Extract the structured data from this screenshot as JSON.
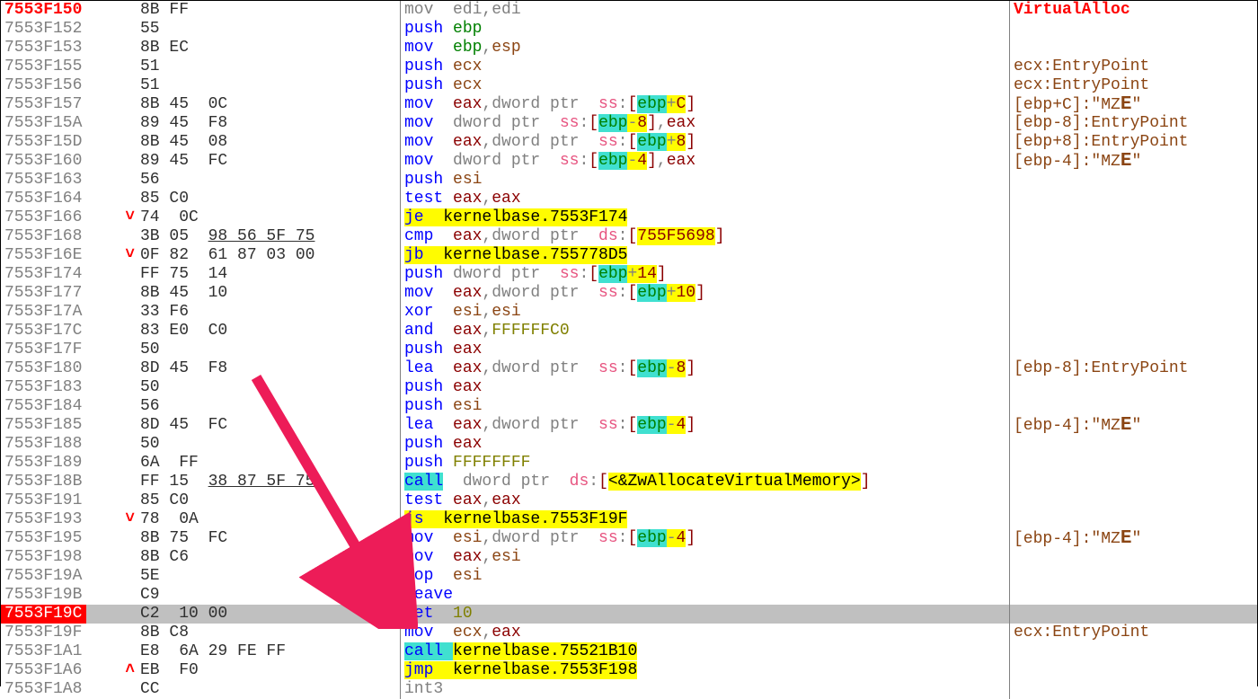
{
  "selected_index": 33,
  "rows": [
    {
      "addr": "7553F150",
      "addr_style": "entry",
      "jump": "",
      "bytes": "8B FF",
      "disasm": [
        [
          "c-gray",
          "mov  edi,edi"
        ]
      ],
      "comment": [
        [
          "c-red",
          "VirtualAlloc"
        ]
      ]
    },
    {
      "addr": "7553F152",
      "jump": "",
      "bytes": "55",
      "disasm": [
        [
          "c-blue",
          "push "
        ],
        [
          "c-green",
          "ebp"
        ]
      ],
      "comment": []
    },
    {
      "addr": "7553F153",
      "jump": "",
      "bytes": "8B EC",
      "disasm": [
        [
          "c-blue",
          "mov  "
        ],
        [
          "c-green",
          "ebp"
        ],
        [
          "c-gray",
          ","
        ],
        [
          "c-brown",
          "esp"
        ]
      ],
      "comment": []
    },
    {
      "addr": "7553F155",
      "jump": "",
      "bytes": "51",
      "disasm": [
        [
          "c-blue",
          "push "
        ],
        [
          "c-brown",
          "ecx"
        ]
      ],
      "comment": [
        [
          "c-brown",
          "ecx:EntryPoint"
        ]
      ]
    },
    {
      "addr": "7553F156",
      "jump": "",
      "bytes": "51",
      "disasm": [
        [
          "c-blue",
          "push "
        ],
        [
          "c-brown",
          "ecx"
        ]
      ],
      "comment": [
        [
          "c-brown",
          "ecx:EntryPoint"
        ]
      ]
    },
    {
      "addr": "7553F157",
      "jump": "",
      "bytes": "8B 45  0C",
      "disasm": [
        [
          "c-blue",
          "mov  "
        ],
        [
          "c-darkred",
          "eax"
        ],
        [
          "c-gray",
          ",dword ptr  "
        ],
        [
          "c-pink",
          "ss"
        ],
        [
          "c-gray",
          ":"
        ],
        [
          "c-darkred",
          "["
        ],
        [
          "c-green bg-cyan",
          "ebp"
        ],
        [
          "c-gray bg-yellow",
          "+"
        ],
        [
          "c-darkred bg-yellow",
          "C"
        ],
        [
          "c-darkred",
          "]"
        ]
      ],
      "comment": [
        [
          "c-brown",
          "[ebp+C]:\"MZ"
        ],
        [
          "c-brown big",
          "E"
        ],
        [
          "c-brown",
          "\""
        ]
      ]
    },
    {
      "addr": "7553F15A",
      "jump": "",
      "bytes": "89 45  F8",
      "disasm": [
        [
          "c-blue",
          "mov  "
        ],
        [
          "c-gray",
          "dword ptr  "
        ],
        [
          "c-pink",
          "ss"
        ],
        [
          "c-gray",
          ":"
        ],
        [
          "c-darkred",
          "["
        ],
        [
          "c-green bg-cyan",
          "ebp"
        ],
        [
          "c-gray bg-yellow",
          "-"
        ],
        [
          "c-darkred bg-yellow",
          "8"
        ],
        [
          "c-darkred",
          "]"
        ],
        [
          "c-gray",
          ","
        ],
        [
          "c-darkred",
          "eax"
        ]
      ],
      "comment": [
        [
          "c-brown",
          "[ebp-8]:EntryPoint"
        ]
      ]
    },
    {
      "addr": "7553F15D",
      "jump": "",
      "bytes": "8B 45  08",
      "disasm": [
        [
          "c-blue",
          "mov  "
        ],
        [
          "c-darkred",
          "eax"
        ],
        [
          "c-gray",
          ",dword ptr  "
        ],
        [
          "c-pink",
          "ss"
        ],
        [
          "c-gray",
          ":"
        ],
        [
          "c-darkred",
          "["
        ],
        [
          "c-green bg-cyan",
          "ebp"
        ],
        [
          "c-gray bg-yellow",
          "+"
        ],
        [
          "c-darkred bg-yellow",
          "8"
        ],
        [
          "c-darkred",
          "]"
        ]
      ],
      "comment": [
        [
          "c-brown",
          "[ebp+8]:EntryPoint"
        ]
      ]
    },
    {
      "addr": "7553F160",
      "jump": "",
      "bytes": "89 45  FC",
      "disasm": [
        [
          "c-blue",
          "mov  "
        ],
        [
          "c-gray",
          "dword ptr  "
        ],
        [
          "c-pink",
          "ss"
        ],
        [
          "c-gray",
          ":"
        ],
        [
          "c-darkred",
          "["
        ],
        [
          "c-green bg-cyan",
          "ebp"
        ],
        [
          "c-gray bg-yellow",
          "-"
        ],
        [
          "c-darkred bg-yellow",
          "4"
        ],
        [
          "c-darkred",
          "]"
        ],
        [
          "c-gray",
          ","
        ],
        [
          "c-darkred",
          "eax"
        ]
      ],
      "comment": [
        [
          "c-brown",
          "[ebp-4]:\"MZ"
        ],
        [
          "c-brown big",
          "E"
        ],
        [
          "c-brown",
          "\""
        ]
      ]
    },
    {
      "addr": "7553F163",
      "jump": "",
      "bytes": "56",
      "disasm": [
        [
          "c-blue",
          "push "
        ],
        [
          "c-brown",
          "esi"
        ]
      ],
      "comment": []
    },
    {
      "addr": "7553F164",
      "jump": "",
      "bytes": "85 C0",
      "disasm": [
        [
          "c-blue",
          "test "
        ],
        [
          "c-darkred",
          "eax"
        ],
        [
          "c-gray",
          ","
        ],
        [
          "c-darkred",
          "eax"
        ]
      ],
      "comment": []
    },
    {
      "addr": "7553F166",
      "jump": "˅",
      "bytes": "74  0C",
      "disasm": [
        [
          "c-blue bg-yellow",
          "je  "
        ],
        [
          "c-black bg-yellow",
          "kernelbase.7553F174"
        ]
      ],
      "comment": []
    },
    {
      "addr": "7553F168",
      "jump": "",
      "bytes": [
        [
          "",
          "3B 05  "
        ],
        [
          "ul",
          "98 56 5F 75"
        ]
      ],
      "disasm": [
        [
          "c-blue",
          "cmp  "
        ],
        [
          "c-darkred",
          "eax"
        ],
        [
          "c-gray",
          ",dword ptr  "
        ],
        [
          "c-pink",
          "ds"
        ],
        [
          "c-gray",
          ":"
        ],
        [
          "c-darkred",
          "["
        ],
        [
          "c-darkred bg-yellow",
          "755F5698"
        ],
        [
          "c-darkred",
          "]"
        ]
      ],
      "comment": []
    },
    {
      "addr": "7553F16E",
      "jump": "˅",
      "bytes": "0F 82  61 87 03 00",
      "disasm": [
        [
          "c-blue bg-yellow",
          "jb  "
        ],
        [
          "c-black bg-yellow",
          "kernelbase.755778D5"
        ]
      ],
      "comment": []
    },
    {
      "addr": "7553F174",
      "jump": "",
      "bytes": "FF 75  14",
      "disasm": [
        [
          "c-blue",
          "push "
        ],
        [
          "c-gray",
          "dword ptr  "
        ],
        [
          "c-pink",
          "ss"
        ],
        [
          "c-gray",
          ":"
        ],
        [
          "c-darkred",
          "["
        ],
        [
          "c-green bg-cyan",
          "ebp"
        ],
        [
          "c-gray bg-yellow",
          "+"
        ],
        [
          "c-darkred bg-yellow",
          "14"
        ],
        [
          "c-darkred",
          "]"
        ]
      ],
      "comment": []
    },
    {
      "addr": "7553F177",
      "jump": "",
      "bytes": "8B 45  10",
      "disasm": [
        [
          "c-blue",
          "mov  "
        ],
        [
          "c-darkred",
          "eax"
        ],
        [
          "c-gray",
          ",dword ptr  "
        ],
        [
          "c-pink",
          "ss"
        ],
        [
          "c-gray",
          ":"
        ],
        [
          "c-darkred",
          "["
        ],
        [
          "c-green bg-cyan",
          "ebp"
        ],
        [
          "c-gray bg-yellow",
          "+"
        ],
        [
          "c-darkred bg-yellow",
          "10"
        ],
        [
          "c-darkred",
          "]"
        ]
      ],
      "comment": []
    },
    {
      "addr": "7553F17A",
      "jump": "",
      "bytes": "33 F6",
      "disasm": [
        [
          "c-blue",
          "xor  "
        ],
        [
          "c-brown",
          "esi"
        ],
        [
          "c-gray",
          ","
        ],
        [
          "c-brown",
          "esi"
        ]
      ],
      "comment": []
    },
    {
      "addr": "7553F17C",
      "jump": "",
      "bytes": "83 E0  C0",
      "disasm": [
        [
          "c-blue",
          "and  "
        ],
        [
          "c-darkred",
          "eax"
        ],
        [
          "c-gray",
          ","
        ],
        [
          "c-olive",
          "FFFFFFC0"
        ]
      ],
      "comment": []
    },
    {
      "addr": "7553F17F",
      "jump": "",
      "bytes": "50",
      "disasm": [
        [
          "c-blue",
          "push "
        ],
        [
          "c-darkred",
          "eax"
        ]
      ],
      "comment": []
    },
    {
      "addr": "7553F180",
      "jump": "",
      "bytes": "8D 45  F8",
      "disasm": [
        [
          "c-blue",
          "lea  "
        ],
        [
          "c-darkred",
          "eax"
        ],
        [
          "c-gray",
          ",dword ptr  "
        ],
        [
          "c-pink",
          "ss"
        ],
        [
          "c-gray",
          ":"
        ],
        [
          "c-darkred",
          "["
        ],
        [
          "c-green bg-cyan",
          "ebp"
        ],
        [
          "c-gray bg-yellow",
          "-"
        ],
        [
          "c-darkred bg-yellow",
          "8"
        ],
        [
          "c-darkred",
          "]"
        ]
      ],
      "comment": [
        [
          "c-brown",
          "[ebp-8]:EntryPoint"
        ]
      ]
    },
    {
      "addr": "7553F183",
      "jump": "",
      "bytes": "50",
      "disasm": [
        [
          "c-blue",
          "push "
        ],
        [
          "c-darkred",
          "eax"
        ]
      ],
      "comment": []
    },
    {
      "addr": "7553F184",
      "jump": "",
      "bytes": "56",
      "disasm": [
        [
          "c-blue",
          "push "
        ],
        [
          "c-brown",
          "esi"
        ]
      ],
      "comment": []
    },
    {
      "addr": "7553F185",
      "jump": "",
      "bytes": "8D 45  FC",
      "disasm": [
        [
          "c-blue",
          "lea  "
        ],
        [
          "c-darkred",
          "eax"
        ],
        [
          "c-gray",
          ",dword ptr  "
        ],
        [
          "c-pink",
          "ss"
        ],
        [
          "c-gray",
          ":"
        ],
        [
          "c-darkred",
          "["
        ],
        [
          "c-green bg-cyan",
          "ebp"
        ],
        [
          "c-gray bg-yellow",
          "-"
        ],
        [
          "c-darkred bg-yellow",
          "4"
        ],
        [
          "c-darkred",
          "]"
        ]
      ],
      "comment": [
        [
          "c-brown",
          "[ebp-4]:\"MZ"
        ],
        [
          "c-brown big",
          "E"
        ],
        [
          "c-brown",
          "\""
        ]
      ]
    },
    {
      "addr": "7553F188",
      "jump": "",
      "bytes": "50",
      "disasm": [
        [
          "c-blue",
          "push "
        ],
        [
          "c-darkred",
          "eax"
        ]
      ],
      "comment": []
    },
    {
      "addr": "7553F189",
      "jump": "",
      "bytes": "6A  FF",
      "disasm": [
        [
          "c-blue",
          "push "
        ],
        [
          "c-olive",
          "FFFFFFFF"
        ]
      ],
      "comment": []
    },
    {
      "addr": "7553F18B",
      "jump": "",
      "bytes": [
        [
          "",
          "FF 15  "
        ],
        [
          "ul",
          "38 87 5F 75"
        ]
      ],
      "disasm": [
        [
          "c-blue bg-cyan",
          "call"
        ],
        [
          "c-gray",
          "  dword ptr  "
        ],
        [
          "c-pink",
          "ds"
        ],
        [
          "c-gray",
          ":"
        ],
        [
          "c-darkred",
          "["
        ],
        [
          "c-black bg-yellow",
          "<&ZwAllocateVirtualMemory>"
        ],
        [
          "c-darkred",
          "]"
        ]
      ],
      "comment": []
    },
    {
      "addr": "7553F191",
      "jump": "",
      "bytes": "85 C0",
      "disasm": [
        [
          "c-blue",
          "test "
        ],
        [
          "c-darkred",
          "eax"
        ],
        [
          "c-gray",
          ","
        ],
        [
          "c-darkred",
          "eax"
        ]
      ],
      "comment": []
    },
    {
      "addr": "7553F193",
      "jump": "˅",
      "bytes": "78  0A",
      "disasm": [
        [
          "c-blue bg-yellow",
          "js  "
        ],
        [
          "c-black bg-yellow",
          "kernelbase.7553F19F"
        ]
      ],
      "comment": []
    },
    {
      "addr": "7553F195",
      "jump": "",
      "bytes": "8B 75  FC",
      "disasm": [
        [
          "c-blue",
          "mov  "
        ],
        [
          "c-brown",
          "esi"
        ],
        [
          "c-gray",
          ",dword ptr  "
        ],
        [
          "c-pink",
          "ss"
        ],
        [
          "c-gray",
          ":"
        ],
        [
          "c-darkred",
          "["
        ],
        [
          "c-green bg-cyan",
          "ebp"
        ],
        [
          "c-gray bg-yellow",
          "-"
        ],
        [
          "c-darkred bg-yellow",
          "4"
        ],
        [
          "c-darkred",
          "]"
        ]
      ],
      "comment": [
        [
          "c-brown",
          "[ebp-4]:\"MZ"
        ],
        [
          "c-brown big",
          "E"
        ],
        [
          "c-brown",
          "\""
        ]
      ]
    },
    {
      "addr": "7553F198",
      "jump": "",
      "bytes": "8B C6",
      "disasm": [
        [
          "c-blue",
          "mov  "
        ],
        [
          "c-darkred",
          "eax"
        ],
        [
          "c-gray",
          ","
        ],
        [
          "c-brown",
          "esi"
        ]
      ],
      "comment": []
    },
    {
      "addr": "7553F19A",
      "jump": "",
      "bytes": "5E",
      "disasm": [
        [
          "c-blue",
          "pop  "
        ],
        [
          "c-brown",
          "esi"
        ]
      ],
      "comment": []
    },
    {
      "addr": "7553F19B",
      "jump": "",
      "bytes": "C9",
      "disasm": [
        [
          "c-blue",
          "leave"
        ]
      ],
      "comment": []
    },
    {
      "addr": "7553F19C",
      "selected": true,
      "jump": "",
      "bytes": "C2  10 00",
      "disasm": [
        [
          "c-blue",
          "ret  "
        ],
        [
          "c-olive",
          "10"
        ]
      ],
      "comment": []
    },
    {
      "addr": "7553F19F",
      "jump": "",
      "bytes": "8B C8",
      "disasm": [
        [
          "c-blue",
          "mov  "
        ],
        [
          "c-brown",
          "ecx"
        ],
        [
          "c-gray",
          ","
        ],
        [
          "c-darkred",
          "eax"
        ]
      ],
      "comment": [
        [
          "c-brown",
          "ecx:EntryPoint"
        ]
      ]
    },
    {
      "addr": "7553F1A1",
      "jump": "",
      "bytes": "E8  6A 29 FE FF",
      "disasm": [
        [
          "c-blue bg-cyan",
          "call "
        ],
        [
          "c-black bg-yellow",
          "kernelbase.75521B10"
        ]
      ],
      "comment": []
    },
    {
      "addr": "7553F1A6",
      "jump": "˄",
      "bytes": "EB  F0",
      "disasm": [
        [
          "c-blue bg-yellow",
          "jmp  "
        ],
        [
          "c-black bg-yellow",
          "kernelbase.7553F198"
        ]
      ],
      "comment": []
    },
    {
      "addr": "7553F1A8",
      "jump": "",
      "bytes": "CC",
      "disasm": [
        [
          "c-gray",
          "int3"
        ]
      ],
      "comment": []
    }
  ],
  "arrow": {
    "color": "#ed1c58"
  }
}
